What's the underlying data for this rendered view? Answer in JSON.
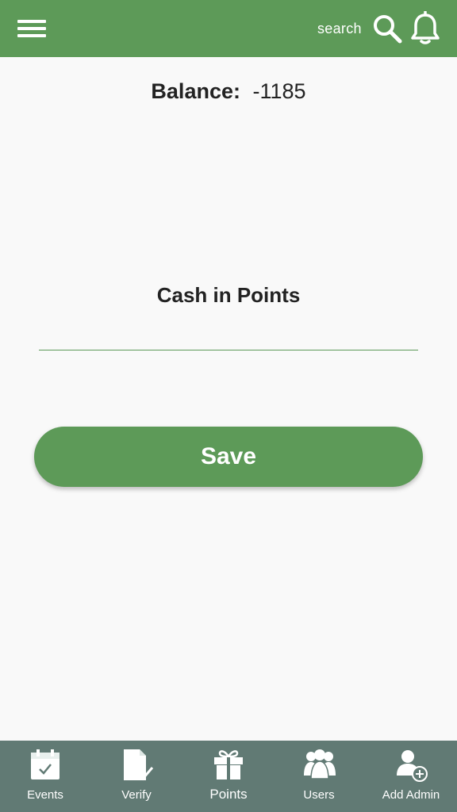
{
  "header": {
    "search_label": "search",
    "icons": [
      "menu-icon",
      "search-icon",
      "bell-icon"
    ]
  },
  "balance": {
    "label": "Balance:",
    "value": "-1185"
  },
  "form": {
    "title": "Cash in Points",
    "input_value": "",
    "save_label": "Save"
  },
  "nav": {
    "items": [
      {
        "label": "Events",
        "icon": "calendar-check-icon"
      },
      {
        "label": "Verify",
        "icon": "document-check-icon"
      },
      {
        "label": "Points",
        "icon": "gift-icon"
      },
      {
        "label": "Users",
        "icon": "users-group-icon"
      },
      {
        "label": "Add Admin",
        "icon": "add-user-icon"
      }
    ]
  },
  "colors": {
    "primary": "#5d9a58",
    "bottom_nav": "#617a74",
    "background": "#f9f9f9"
  }
}
